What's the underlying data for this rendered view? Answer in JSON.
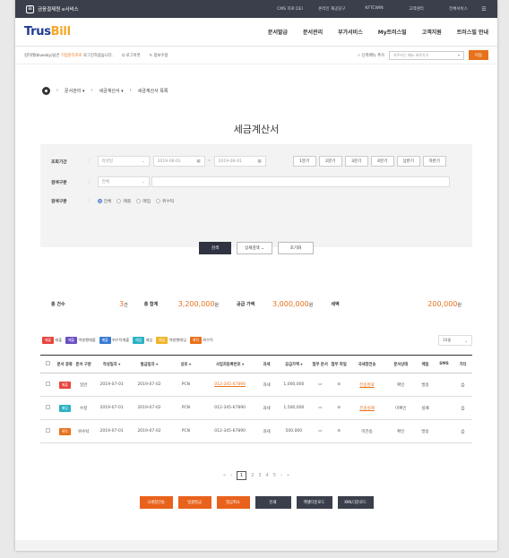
{
  "topbar": {
    "brand": "금융결제원 e서비스",
    "links": [
      "CMS 지로 DEI",
      "온라인 재공당구",
      "KFTCWIN",
      "고객센터",
      "전체서비스"
    ]
  },
  "header": {
    "logo_main": "Trus",
    "logo_accent": "Bill",
    "nav": [
      "문서발급",
      "문서관리",
      "부가서비스",
      "My트러스빌",
      "고객지원",
      "트러스빌 안내"
    ]
  },
  "userbar": {
    "msg_prefix": "김미래(bluesky)님은 ",
    "msg_highlight": "기업관리자로",
    "msg_suffix": " 로그인하셨습니다.",
    "logout": "로그아웃",
    "edit": "정보수정",
    "favorite": "☆ 단축메뉴 추가",
    "menu_placeholder": "자주쓰는 메뉴 바로가기",
    "go": "이동"
  },
  "breadcrumb": [
    "문서관리",
    "세금계산서",
    "세금계산서 목록"
  ],
  "page_title": "세금계산서",
  "search": {
    "period_label": "조회기간",
    "period_type": "작성일",
    "date_from": "2019-06-01",
    "date_to": "2019-06-01",
    "quick": [
      "1분기",
      "2분기",
      "3분기",
      "4분기",
      "상반기",
      "하반기"
    ],
    "kind_label": "검색구분",
    "kind_value": "전체",
    "kind2_label": "검색구분",
    "radios": [
      "전체",
      "매출",
      "매입",
      "위수탁"
    ],
    "btn_search": "검색",
    "btn_detail": "상세검색",
    "btn_reset": "초기화"
  },
  "summary": {
    "count_label": "총 건수",
    "count_value": "3",
    "count_unit": "건",
    "total_label": "총 합계",
    "total_value": "3,200,000",
    "total_unit": "원",
    "supply_label": "공급 가액",
    "supply_value": "3,000,000",
    "supply_unit": "원",
    "tax_label": "세액",
    "tax_value": "200,000",
    "tax_unit": "원"
  },
  "legend": {
    "items": [
      {
        "tag": "매출",
        "text": "매출",
        "color": "#e8453c"
      },
      {
        "tag": "매출",
        "text": "역발행매출",
        "color": "#6a4fc4"
      },
      {
        "tag": "매출",
        "text": "위수탁매출",
        "color": "#3a7bd5"
      },
      {
        "tag": "매입",
        "text": "매입",
        "color": "#2bb1c4"
      },
      {
        "tag": "매입",
        "text": "역발행매입",
        "color": "#f0b429"
      },
      {
        "tag": "위탁",
        "text": "위수탁",
        "color": "#e8721c"
      }
    ],
    "per_page": "10줄"
  },
  "table": {
    "headers": [
      "문서 종류",
      "문서 구분",
      "작성일자 ▾",
      "발급일자 ▾",
      "상호 ▾",
      "사업자등록번호 ▾",
      "과세",
      "공급가액 ▾",
      "첨부 문서",
      "첨부 파일",
      "국세청전송",
      "문서상태",
      "메일",
      "SMS",
      "기타"
    ],
    "rows": [
      {
        "tag": "매출",
        "tag_color": "#e8453c",
        "kind": "일반",
        "write": "2019-07-01",
        "issue": "2019-07-02",
        "name": "PCN",
        "bizno": "012-345-67890",
        "tax": "과세",
        "amount": "1,000,000",
        "nts": "전송완료",
        "status": "확인",
        "mail": "발송"
      },
      {
        "tag": "매입",
        "tag_color": "#2bb1c4",
        "kind": "수정",
        "write": "2019-07-01",
        "issue": "2019-07-02",
        "name": "PCN",
        "bizno": "012-345-67890",
        "tax": "과세",
        "amount": "1,500,000",
        "nts": "전송실패",
        "status": "미확인",
        "mail": "실패"
      },
      {
        "tag": "위탁",
        "tag_color": "#e8721c",
        "kind": "위수탁",
        "write": "2019-07-01",
        "issue": "2019-07-02",
        "name": "PCN",
        "bizno": "012-345-67890",
        "tax": "과세",
        "amount": "500,000",
        "nts": "미전송",
        "status": "확인",
        "mail": "발송"
      }
    ]
  },
  "pager": {
    "pages": [
      "1",
      "2",
      "3",
      "4",
      "5"
    ]
  },
  "bottom_buttons": [
    "국세청전송",
    "일괄발급",
    "발급취소",
    "인쇄",
    "엑셀다운로드",
    "XML다운로드"
  ]
}
